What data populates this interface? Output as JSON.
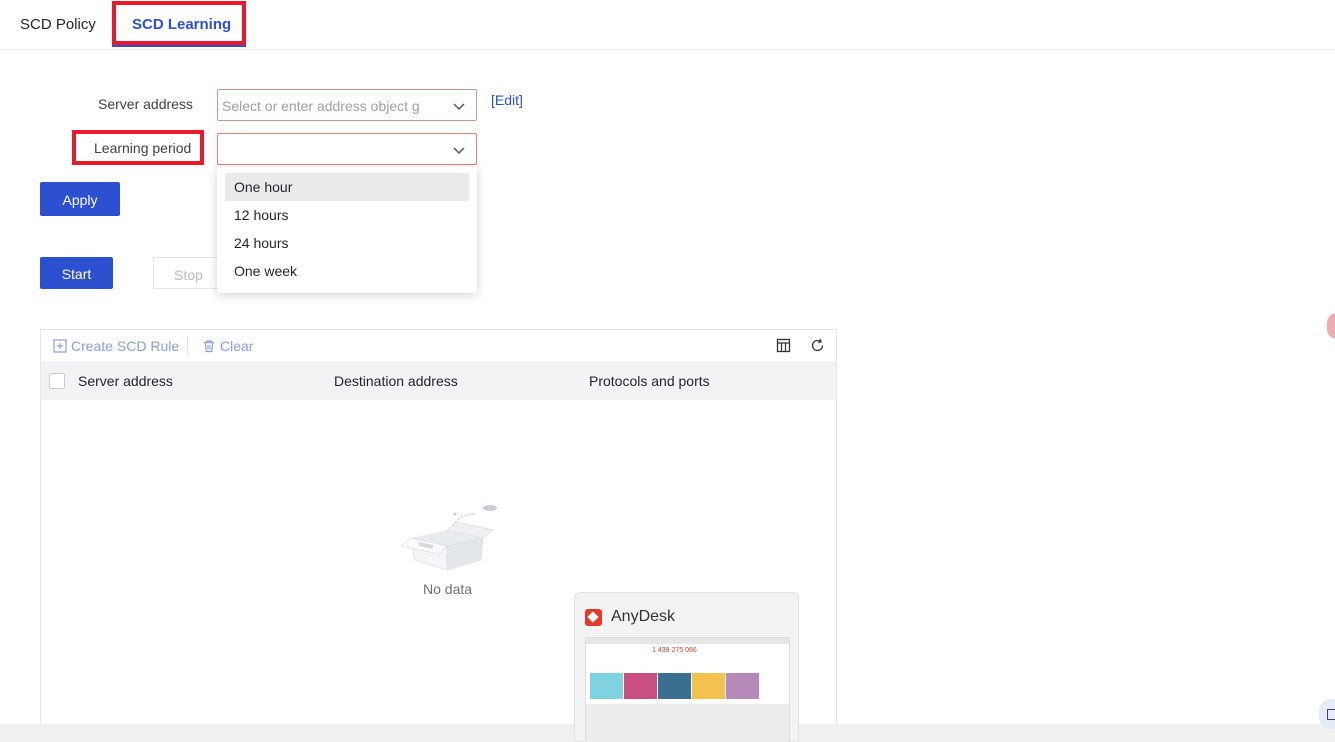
{
  "tabs": [
    {
      "label": "SCD Policy",
      "active": false
    },
    {
      "label": "SCD Learning",
      "active": true
    }
  ],
  "form": {
    "server_address_label": "Server address",
    "server_address_placeholder": "Select or enter address object g",
    "edit_link": "[Edit]",
    "learning_period_label": "Learning period",
    "learning_period_value": "",
    "apply_label": "Apply"
  },
  "dropdown": {
    "options": [
      "One hour",
      "12 hours",
      "24 hours",
      "One week"
    ],
    "highlighted": "One hour"
  },
  "controls": {
    "start_label": "Start",
    "stop_label": "Stop"
  },
  "table": {
    "toolbar": {
      "create_label": "Create SCD Rule",
      "clear_label": "Clear",
      "columns_icon": "columns-icon",
      "refresh_icon": "refresh-icon"
    },
    "columns": [
      "Server address",
      "Destination address",
      "Protocols and ports"
    ],
    "rows": [],
    "empty_text": "No data"
  },
  "anydesk_popup": {
    "title": "AnyDesk",
    "thumbnail_number": "1 439 275 066"
  },
  "colors": {
    "accent": "#2c50d0",
    "highlight_frame": "#e8192c",
    "anydesk_red": "#e8372b"
  }
}
